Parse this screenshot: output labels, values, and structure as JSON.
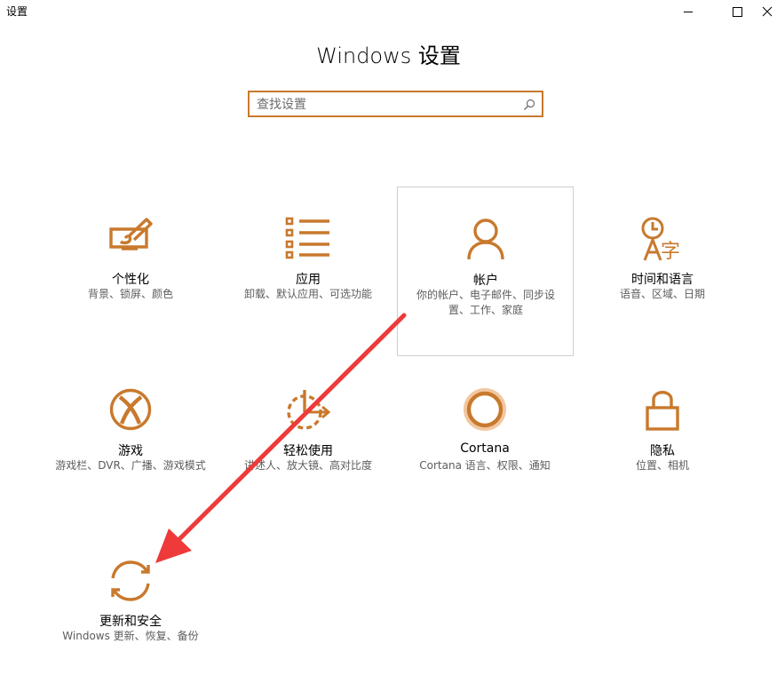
{
  "window": {
    "title": "设置",
    "min_symbol": "",
    "max_symbol": "",
    "close_symbol": "×"
  },
  "header": {
    "title": "Windows 设置"
  },
  "search": {
    "placeholder": "查找设置",
    "value": ""
  },
  "tiles": [
    {
      "id": "personalization",
      "icon": "paint-brush-icon",
      "name": "个性化",
      "desc": "背景、锁屏、颜色"
    },
    {
      "id": "apps",
      "icon": "apps-list-icon",
      "name": "应用",
      "desc": "卸载、默认应用、可选功能"
    },
    {
      "id": "accounts",
      "icon": "person-icon",
      "name": "帐户",
      "desc": "你的帐户、电子邮件、同步设置、工作、家庭"
    },
    {
      "id": "time-language",
      "icon": "time-language-icon",
      "name": "时间和语言",
      "desc": "语音、区域、日期"
    },
    {
      "id": "gaming",
      "icon": "xbox-icon",
      "name": "游戏",
      "desc": "游戏栏、DVR、广播、游戏模式"
    },
    {
      "id": "ease-of-access",
      "icon": "ease-of-access-icon",
      "name": "轻松使用",
      "desc": "讲述人、放大镜、高对比度"
    },
    {
      "id": "cortana",
      "icon": "cortana-icon",
      "name": "Cortana",
      "desc": "Cortana 语言、权限、通知"
    },
    {
      "id": "privacy",
      "icon": "lock-icon",
      "name": "隐私",
      "desc": "位置、相机"
    },
    {
      "id": "update-security",
      "icon": "sync-icon",
      "name": "更新和安全",
      "desc": "Windows 更新、恢复、备份"
    }
  ],
  "colors": {
    "accent": "#c8792d",
    "arrow": "#ee3a3a"
  }
}
